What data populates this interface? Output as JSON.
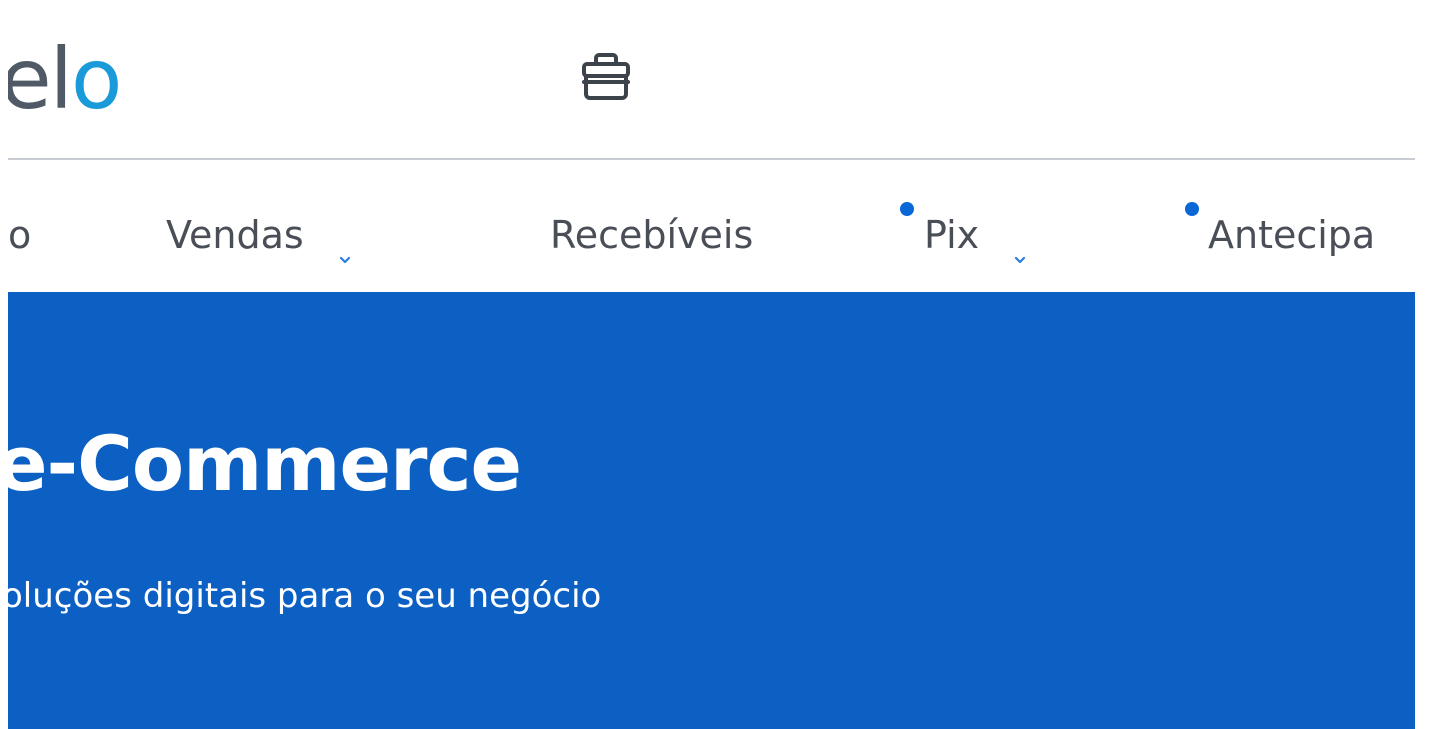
{
  "header": {
    "logo_text_main": "el",
    "logo_text_accent": "o",
    "store_icon": "store-icon"
  },
  "nav": {
    "items": [
      {
        "label": "o",
        "has_dropdown": false,
        "has_dot": false
      },
      {
        "label": "Vendas",
        "has_dropdown": true,
        "has_dot": false
      },
      {
        "label": "Recebíveis",
        "has_dropdown": false,
        "has_dot": false
      },
      {
        "label": "Pix",
        "has_dropdown": true,
        "has_dot": true
      },
      {
        "label": "Antecipa",
        "has_dropdown": false,
        "has_dot": true
      }
    ],
    "chevron_icon": "chevron-down-icon"
  },
  "hero": {
    "title": "e-Commerce",
    "subtitle": "oluções digitais para o seu negócio"
  },
  "colors": {
    "hero_background": "#0c5fc3",
    "accent": "#1a9ad8",
    "dot": "#0a67d6",
    "nav_text": "#4a4f57",
    "logo_text": "#505a66",
    "divider": "#c8ccd3"
  }
}
